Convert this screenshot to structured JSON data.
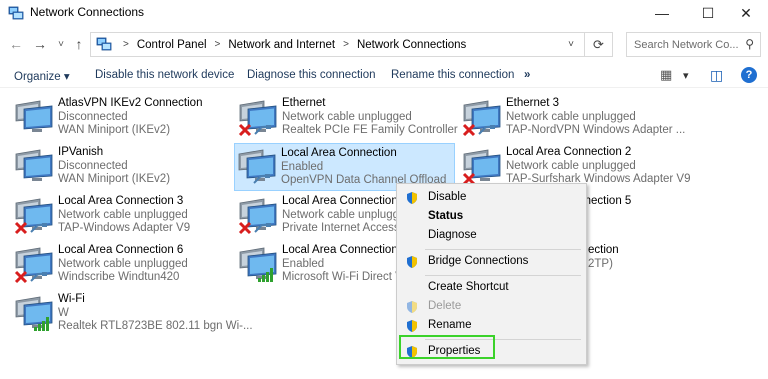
{
  "window": {
    "title": "Network Connections",
    "minimize": "—",
    "maximize": "☐",
    "close": "✕"
  },
  "nav": {
    "back": "←",
    "forward": "→",
    "recent": "˅",
    "up": "↑",
    "breadcrumb": [
      "Control Panel",
      "Network and Internet",
      "Network Connections"
    ],
    "dropdown": "˅",
    "refresh": "⟳",
    "search_placeholder": "Search Network Co...",
    "search_icon": "⚲"
  },
  "toolbar": {
    "organize": "Organize ▾",
    "disable": "Disable this network device",
    "diagnose": "Diagnose this connection",
    "rename": "Rename this connection",
    "more": "»",
    "view_icon": "▦",
    "view_dd": "▾",
    "pane_icon": "◫",
    "help": "?"
  },
  "connections": [
    {
      "name": "AtlasVPN IKEv2 Connection",
      "status": "Disconnected",
      "device": "WAN Miniport (IKEv2)",
      "icon": "network-adapter-icon",
      "badge": "none"
    },
    {
      "name": "Ethernet",
      "status": "Network cable unplugged",
      "device": "Realtek PCIe FE Family Controller",
      "icon": "network-adapter-icon",
      "badge": "red-x"
    },
    {
      "name": "Ethernet 3",
      "status": "Network cable unplugged",
      "device": "TAP-NordVPN Windows Adapter ...",
      "icon": "network-adapter-icon",
      "badge": "red-x"
    },
    {
      "name": "IPVanish",
      "status": "Disconnected",
      "device": "WAN Miniport (IKEv2)",
      "icon": "network-adapter-icon",
      "badge": "none"
    },
    {
      "name": "Local Area Connection",
      "status": "Enabled",
      "device": "OpenVPN Data Channel Offload",
      "icon": "network-adapter-icon",
      "badge": "cable"
    },
    {
      "name": "Local Area Connection 2",
      "status": "Network cable unplugged",
      "device": "TAP-Surfshark Windows Adapter V9",
      "icon": "network-adapter-icon",
      "badge": "red-x"
    },
    {
      "name": "Local Area Connection 3",
      "status": "Network cable unplugged",
      "device": "TAP-Windows Adapter V9",
      "icon": "network-adapter-icon",
      "badge": "red-x"
    },
    {
      "name": "Local Area Connection 4",
      "status": "Network cable unplugged",
      "device": "Private Internet Access Network",
      "icon": "network-adapter-icon",
      "badge": "red-x"
    },
    {
      "name": "Local Area Connection 5",
      "status": "",
      "device": "",
      "icon": "network-adapter-icon",
      "badge": "red-x"
    },
    {
      "name": "Local Area Connection 6",
      "status": "Network cable unplugged",
      "device": "Windscribe Windtun420",
      "icon": "network-adapter-icon",
      "badge": "red-x"
    },
    {
      "name": "Local Area Connection*",
      "status": "Enabled",
      "device": "Microsoft Wi-Fi Direct Virtual",
      "icon": "network-adapter-icon",
      "badge": "signal"
    },
    {
      "name": "ection",
      "status": "",
      "device": "2TP)",
      "icon": "network-adapter-icon",
      "badge": "none"
    },
    {
      "name": "Wi-Fi",
      "status": "W",
      "device": "Realtek RTL8723BE 802.11 bgn Wi-...",
      "icon": "network-adapter-icon",
      "badge": "signal"
    }
  ],
  "context_menu": {
    "items": [
      {
        "label": "Disable",
        "shield": true,
        "bold": false,
        "disabled": false
      },
      {
        "label": "Status",
        "shield": false,
        "bold": true,
        "disabled": false
      },
      {
        "label": "Diagnose",
        "shield": false,
        "bold": false,
        "disabled": false
      },
      {
        "label": "Bridge Connections",
        "shield": true,
        "bold": false,
        "disabled": false
      },
      {
        "label": "Create Shortcut",
        "shield": false,
        "bold": false,
        "disabled": false
      },
      {
        "label": "Delete",
        "shield": true,
        "bold": false,
        "disabled": true
      },
      {
        "label": "Rename",
        "shield": true,
        "bold": false,
        "disabled": false
      },
      {
        "label": "Properties",
        "shield": true,
        "bold": false,
        "disabled": false
      }
    ]
  },
  "colors": {
    "selection_bg": "#cce8ff",
    "selection_border": "#99d1ff",
    "highlight_box": "#3bd22a",
    "link_text": "#1e395b",
    "secondary_text": "#6d6d6d"
  }
}
